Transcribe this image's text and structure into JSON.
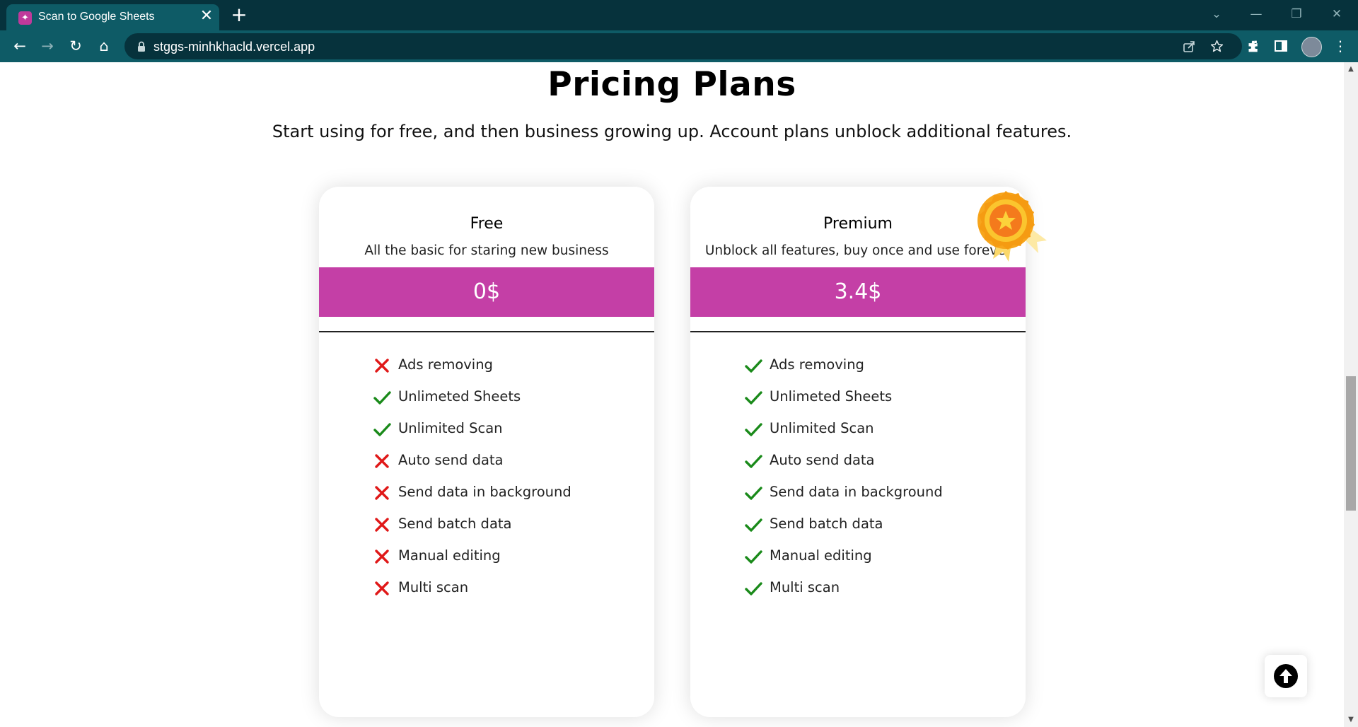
{
  "browser": {
    "tab": {
      "title": "Scan to Google Sheets",
      "favicon_icon": "scan-logo-icon",
      "close_glyph": "✕"
    },
    "new_tab_glyph": "+",
    "window_controls": {
      "dropdown": "⌄",
      "minimize": "—",
      "restore": "❐",
      "close": "✕"
    },
    "nav": {
      "back": "←",
      "forward": "→",
      "reload": "↻",
      "home": "⌂"
    },
    "address": {
      "url": "stggs-minhkhacld.vercel.app"
    },
    "colors": {
      "frame": "#06323c",
      "toolbar": "#0e5b66"
    }
  },
  "page": {
    "heading": "Pricing Plans",
    "subheading": "Start using for free, and then business growing up. Account plans unblock additional features.",
    "accent_color": "#c43fa6",
    "plans": [
      {
        "name": "Free",
        "description": "All the basic for staring new business",
        "price": "0$",
        "features": [
          {
            "label": "Ads removing",
            "included": false
          },
          {
            "label": "Unlimeted Sheets",
            "included": true
          },
          {
            "label": "Unlimited Scan",
            "included": true
          },
          {
            "label": "Auto send data",
            "included": false
          },
          {
            "label": "Send data in background",
            "included": false
          },
          {
            "label": "Send batch data",
            "included": false
          },
          {
            "label": "Manual editing",
            "included": false
          },
          {
            "label": "Multi scan",
            "included": false
          }
        ]
      },
      {
        "name": "Premium",
        "description": "Unblock all features, buy once and use forever",
        "price": "3.4$",
        "badge_icon": "award-badge-icon",
        "features": [
          {
            "label": "Ads removing",
            "included": true
          },
          {
            "label": "Unlimeted Sheets",
            "included": true
          },
          {
            "label": "Unlimited Scan",
            "included": true
          },
          {
            "label": "Auto send data",
            "included": true
          },
          {
            "label": "Send data in background",
            "included": true
          },
          {
            "label": "Send batch data",
            "included": true
          },
          {
            "label": "Manual editing",
            "included": true
          },
          {
            "label": "Multi scan",
            "included": true
          }
        ]
      }
    ],
    "check_color": "#1a8a1a",
    "cross_color": "#e01818",
    "scroll_top_icon": "arrow-up-circle-icon"
  }
}
